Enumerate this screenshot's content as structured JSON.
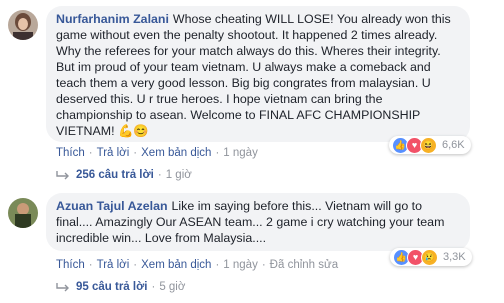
{
  "comments": [
    {
      "author": "Nurfarhanim Zalani",
      "text": "Whose cheating WILL LOSE! You already won this game without even the penalty shootout. It happened 2 times already. Why the referees for your match always do this. Wheres their integrity. But im proud of your team vietnam. U always make a comeback and teach them a very good lesson. Big big congrates from malaysian. U deserved this. U r true heroes. I hope vietnam can bring the championship to asean. Welcome to FINAL AFC CHAMPIONSHIP VIETNAM! 💪😊",
      "actions": {
        "like": "Thích",
        "reply": "Trả lời",
        "translate": "Xem bản dịch",
        "time": "1 ngày"
      },
      "reactions": {
        "icons": [
          "like-icon",
          "love-icon",
          "haha-icon"
        ],
        "count": "6,6K"
      },
      "replies": {
        "label": "256 câu trả lời",
        "time": "1 giờ"
      }
    },
    {
      "author": "Azuan Tajul Azelan",
      "text": "Like im saying before this... Vietnam will go to final.... Amazingly Our ASEAN team... 2 game i cry watching your team incredible win... Love from Malaysia....",
      "actions": {
        "like": "Thích",
        "reply": "Trả lời",
        "translate": "Xem bản dịch",
        "time": "1 ngày",
        "edited": "Đã chỉnh sửa"
      },
      "reactions": {
        "icons": [
          "like-icon",
          "love-icon",
          "sad-icon"
        ],
        "count": "3,3K"
      },
      "replies": {
        "label": "95 câu trả lời",
        "time": "5 giờ"
      }
    }
  ],
  "colors": {
    "link": "#385898",
    "bubble": "#f2f3f5",
    "meta": "#90949c",
    "like": "#5890ff",
    "love": "#f25268",
    "haha": "#f7b125"
  }
}
